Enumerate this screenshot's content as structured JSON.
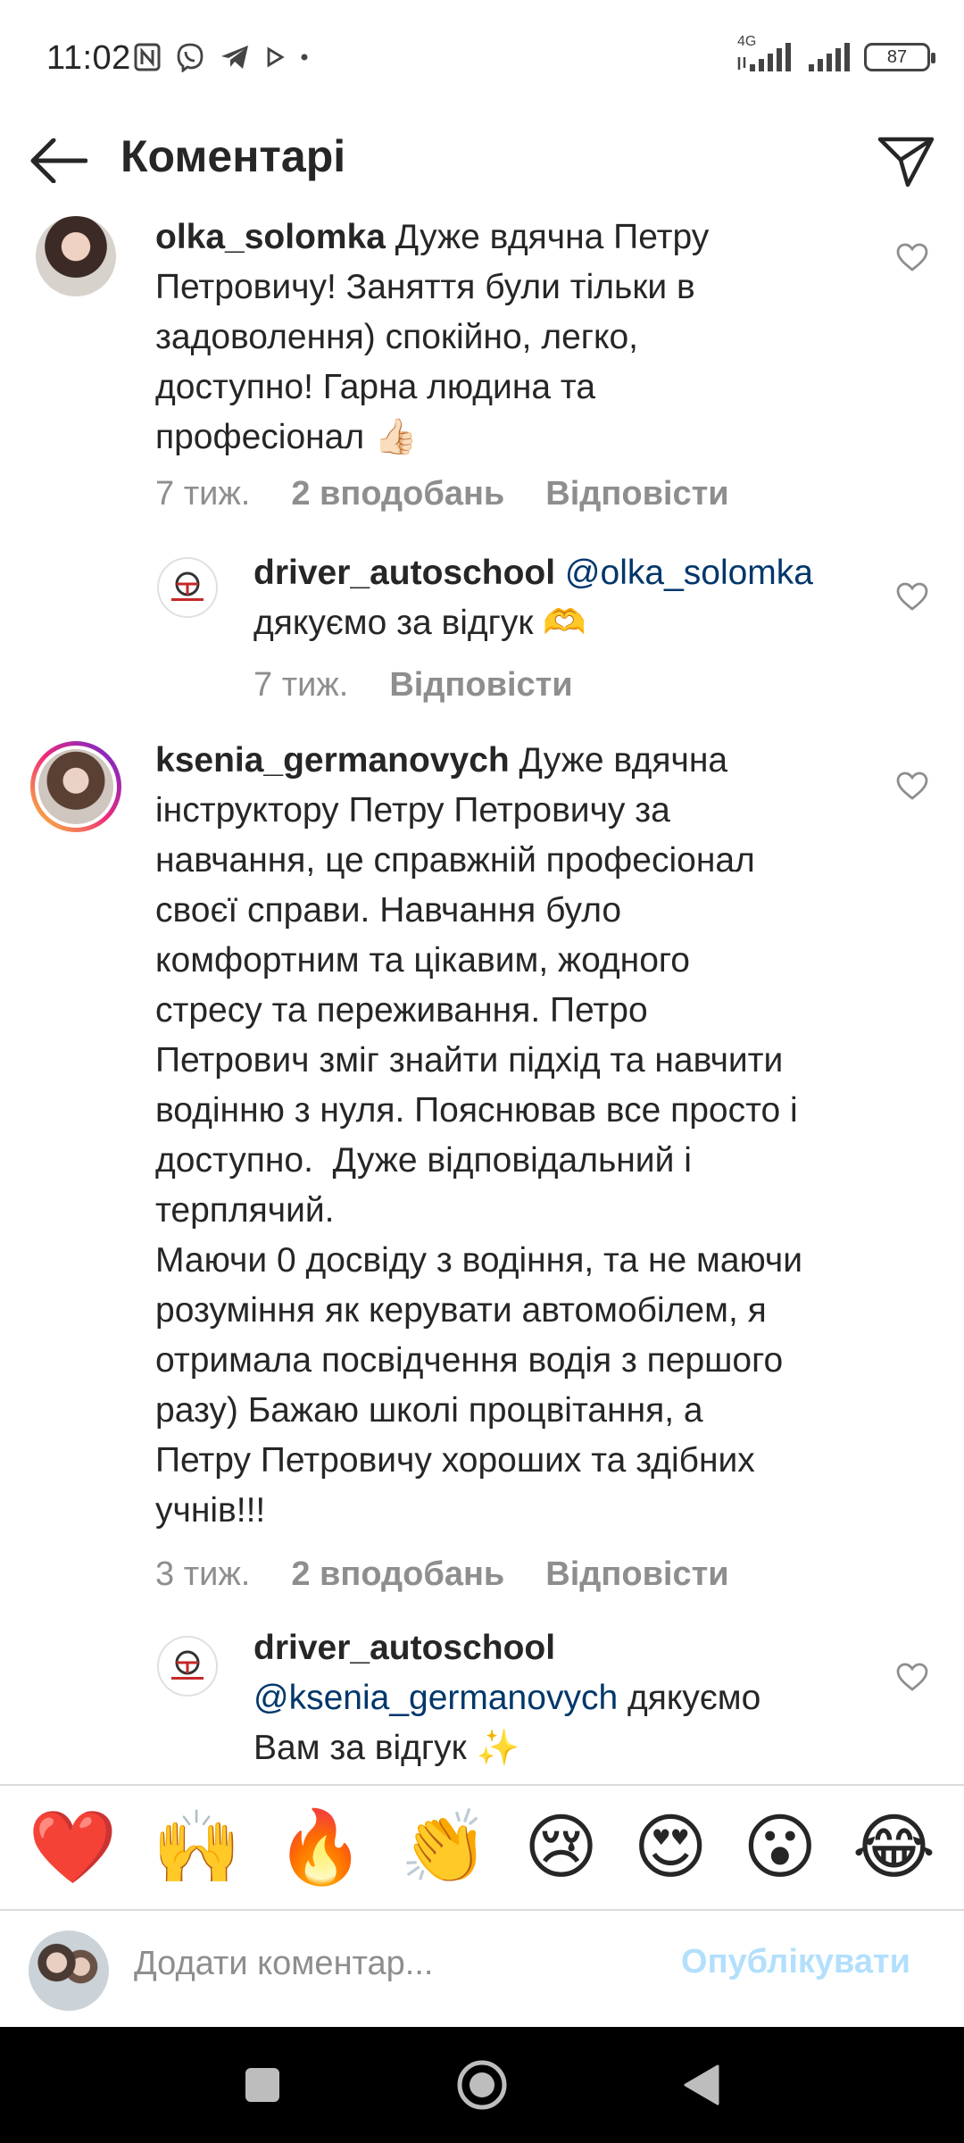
{
  "status_bar": {
    "time": "11:02",
    "network": "4G",
    "battery": "87",
    "icons": [
      "nfc-icon",
      "viber-icon",
      "telegram-icon",
      "play-icon",
      "dot-icon",
      "signal-icon",
      "signal-icon-2",
      "battery-icon"
    ]
  },
  "header": {
    "title": "Коментарі",
    "back_icon": "arrow-left-icon",
    "share_icon": "paper-plane-icon"
  },
  "comments": [
    {
      "username": "olka_solomka",
      "text": " Дуже вдячна Петру\nПетровичу! Заняття були тільки в\nзадоволення) спокійно, легко,\nдоступно! Гарна людина та\nпрофесіонал 👍🏻",
      "time": "7 тиж.",
      "likes": "2 вподобань",
      "reply": "Відповісти"
    },
    {
      "username": "driver_autoschool",
      "mention": " @olka_solomka",
      "text": "\nдякуємо за відгук 🫶",
      "time": "7 тиж.",
      "reply": "Відповісти"
    },
    {
      "username": "ksenia_germanovych",
      "text": " Дуже вдячна\nінструктору Петру Петровичу за\nнавчання, це справжній професіонал\nсвоєї справи. Навчання було\nкомфортним та цікавим, жодного\nстресу та переживання. Петро\nПетрович зміг знайти підхід та навчити\nводінню з нуля. Пояснював все просто і\nдоступно.  Дуже відповідальний і\nтерплячий.\nМаючи 0 досвіду з водіння, та не маючи\nрозуміння як керувати автомобілем, я\nотримала посвідчення водія з першого\nразу) Бажаю школі процвітання, а\nПетру Петровичу хороших та здібних\nучнів!!!",
      "time": "3 тиж.",
      "likes": "2 вподобань",
      "reply": "Відповісти"
    },
    {
      "username": "driver_autoschool",
      "mention": "@ksenia_germanovych",
      "text": " дякуємо\nВам за відгук ✨"
    }
  ],
  "emoji_bar": [
    "❤️",
    "🙌",
    "🔥",
    "👏",
    "😢",
    "😍",
    "😮",
    "😂"
  ],
  "composer": {
    "placeholder": "Додати коментар...",
    "publish_label": "Опублікувати"
  },
  "nav": {
    "recents_icon": "square-icon",
    "home_icon": "circle-home-icon",
    "back_icon": "triangle-back-icon"
  }
}
